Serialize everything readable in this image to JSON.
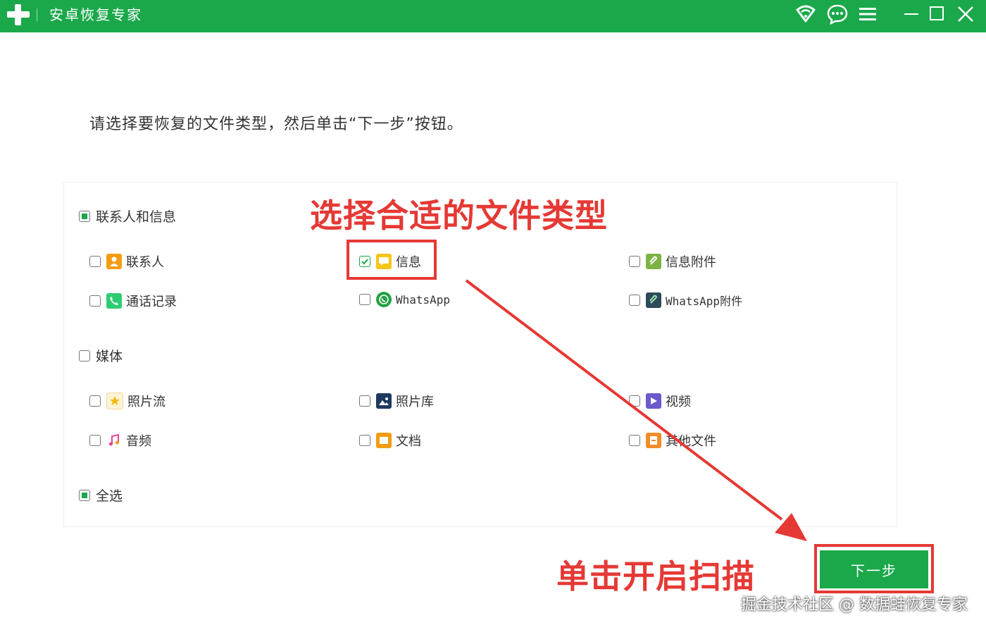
{
  "app": {
    "title": "安卓恢复专家"
  },
  "colors": {
    "brand": "#1aa84b",
    "annotation": "#e53935"
  },
  "instruction": "请选择要恢复的文件类型，然后单击“下一步”按钮。",
  "groups": {
    "contacts_messages": {
      "label": "联系人和信息",
      "state": "partial",
      "items": {
        "contacts": {
          "label": "联系人",
          "checked": false,
          "icon": "contact-icon"
        },
        "messages": {
          "label": "信息",
          "checked": true,
          "icon": "message-icon"
        },
        "message_attachments": {
          "label": "信息附件",
          "checked": false,
          "icon": "attachment-icon"
        },
        "call_logs": {
          "label": "通话记录",
          "checked": false,
          "icon": "phone-icon"
        },
        "whatsapp": {
          "label": "WhatsApp",
          "checked": false,
          "icon": "whatsapp-icon"
        },
        "whatsapp_attachments": {
          "label": "WhatsApp附件",
          "checked": false,
          "icon": "whatsapp-attachment-icon"
        }
      }
    },
    "media": {
      "label": "媒体",
      "state": "unchecked",
      "items": {
        "photo_stream": {
          "label": "照片流",
          "checked": false,
          "icon": "star-icon"
        },
        "gallery": {
          "label": "照片库",
          "checked": false,
          "icon": "image-icon"
        },
        "video": {
          "label": "视频",
          "checked": false,
          "icon": "video-icon"
        },
        "audio": {
          "label": "音频",
          "checked": false,
          "icon": "music-icon"
        },
        "documents": {
          "label": "文档",
          "checked": false,
          "icon": "document-icon"
        },
        "other_files": {
          "label": "其他文件",
          "checked": false,
          "icon": "file-icon"
        }
      }
    }
  },
  "select_all": {
    "label": "全选",
    "state": "partial"
  },
  "annotations": {
    "choose_type": "选择合适的文件类型",
    "click_scan": "单击开启扫描"
  },
  "next_button": {
    "label": "下一步"
  },
  "watermark": "掘金技术社区 @ 数据蛙恢复专家"
}
